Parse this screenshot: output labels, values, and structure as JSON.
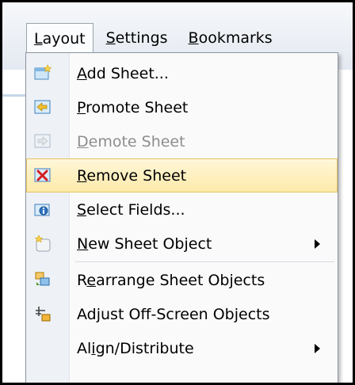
{
  "menubar": {
    "items": [
      {
        "label": "Layout",
        "accel": "L",
        "open": true
      },
      {
        "label": "Settings",
        "accel": "S"
      },
      {
        "label": "Bookmarks",
        "accel": "B"
      }
    ]
  },
  "dropdown": {
    "items": [
      {
        "label": "Add Sheet...",
        "accel": "A",
        "icon": "add-sheet-icon"
      },
      {
        "label": "Promote Sheet",
        "accel": "P",
        "icon": "promote-sheet-icon"
      },
      {
        "label": "Demote Sheet",
        "accel": "D",
        "icon": "demote-sheet-icon",
        "disabled": true
      },
      {
        "label": "Remove Sheet",
        "accel": "R",
        "icon": "remove-sheet-icon",
        "highlighted": true
      },
      {
        "label": "Select Fields...",
        "accel": "S",
        "icon": "select-fields-icon"
      },
      {
        "label": "New Sheet Object",
        "accel": "N",
        "icon": "new-sheet-object-icon",
        "submenu": true
      },
      {
        "label": "Rearrange Sheet Objects",
        "accel": "e",
        "icon": "rearrange-objects-icon"
      },
      {
        "label": "Adjust Off-Screen Objects",
        "accel": "j",
        "icon": "adjust-offscreen-icon"
      },
      {
        "label": "Align/Distribute",
        "accel": "i",
        "icon": "align-distribute-icon",
        "submenu": true
      }
    ]
  }
}
